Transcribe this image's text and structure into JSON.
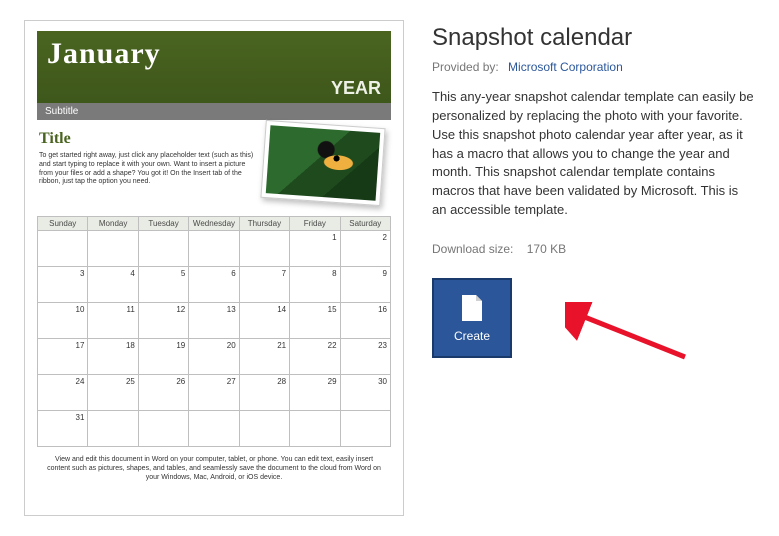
{
  "template": {
    "title": "Snapshot calendar",
    "provided_label": "Provided by:",
    "provider": "Microsoft Corporation",
    "description": "This any-year snapshot calendar template can easily be personalized by replacing the photo with your favorite. Use this snapshot photo calendar year after year, as it has a macro that allows you to change the year and month. This snapshot calendar template contains macros that have been validated by Microsoft. This is an accessible template.",
    "download_label": "Download size:",
    "download_size": "170 KB",
    "create_label": "Create"
  },
  "preview": {
    "month": "January",
    "year": "YEAR",
    "subtitle": "Subtitle",
    "title": "Title",
    "body": "To get started right away, just click any placeholder text (such as this) and start typing to replace it with your own. Want to insert a picture from your files or add a shape? You got it! On the Insert tab of the ribbon, just tap the option you need.",
    "footer": "View and edit this document in Word on your computer, tablet, or phone. You can edit text, easily insert content such as pictures, shapes, and tables, and seamlessly save the document to the cloud from Word on your Windows, Mac, Android, or iOS device.",
    "days": [
      "Sunday",
      "Monday",
      "Tuesday",
      "Wednesday",
      "Thursday",
      "Friday",
      "Saturday"
    ],
    "weeks": [
      [
        "",
        "",
        "",
        "",
        "",
        "1",
        "2"
      ],
      [
        "3",
        "4",
        "5",
        "6",
        "7",
        "8",
        "9"
      ],
      [
        "10",
        "11",
        "12",
        "13",
        "14",
        "15",
        "16"
      ],
      [
        "17",
        "18",
        "19",
        "20",
        "21",
        "22",
        "23"
      ],
      [
        "24",
        "25",
        "26",
        "27",
        "28",
        "29",
        "30"
      ],
      [
        "31",
        "",
        "",
        "",
        "",
        "",
        ""
      ]
    ]
  }
}
